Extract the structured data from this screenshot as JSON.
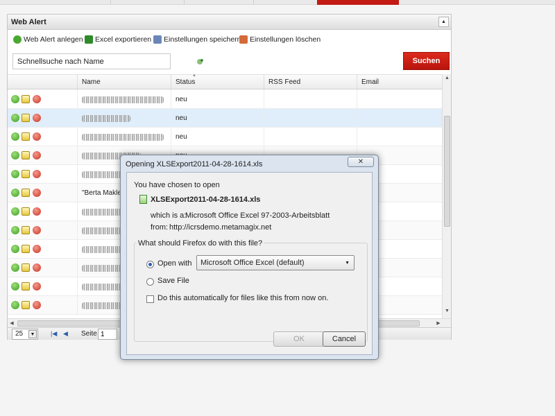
{
  "panel": {
    "title": "Web Alert"
  },
  "toolbar": {
    "items": [
      {
        "label": "Web Alert anlegen",
        "icon": "plus-circle-icon",
        "color": "#4aa832"
      },
      {
        "label": "Excel exportieren",
        "icon": "excel-icon",
        "color": "#2f8a2a"
      },
      {
        "label": "Einstellungen speichern",
        "icon": "save-settings-icon",
        "color": "#6a86b8"
      },
      {
        "label": "Einstellungen löschen",
        "icon": "delete-settings-icon",
        "color": "#d46a3a"
      }
    ]
  },
  "search": {
    "value": "Schnellsuche nach Name",
    "button": "Suchen"
  },
  "grid": {
    "columns": [
      "Name",
      "Status",
      "RSS Feed",
      "Email"
    ],
    "rows": [
      {
        "name": "",
        "status": "neu"
      },
      {
        "name": "",
        "status": "neu"
      },
      {
        "name": "",
        "status": "neu"
      },
      {
        "name": "\"",
        "status": "neu"
      },
      {
        "name": "",
        "status": ""
      },
      {
        "name": "\"Berta Makler\"",
        "status": ""
      },
      {
        "name": "",
        "status": ""
      },
      {
        "name": "",
        "status": ""
      },
      {
        "name": "",
        "status": ""
      },
      {
        "name": "",
        "status": ""
      },
      {
        "name": "",
        "status": ""
      },
      {
        "name": "",
        "status": ""
      }
    ]
  },
  "pager": {
    "page_size": "25",
    "page_label": "Seite",
    "page": "1"
  },
  "dialog": {
    "title": "Opening XLSExport2011-04-28-1614.xls",
    "close": "✕",
    "intro": "You have chosen to open",
    "filename": "XLSExport2011-04-28-1614.xls",
    "type_label": "which is a:",
    "type_value": "Microsoft Office Excel 97-2003-Arbeitsblatt",
    "from_label": "from:",
    "from_value": "http://icrsdemo.metamagix.net",
    "question": "What should Firefox do with this file?",
    "open_with": "Open with",
    "open_with_app": "Microsoft Office Excel (default)",
    "save_file": "Save File",
    "auto": "Do this automatically for files like this from now on.",
    "ok": "OK",
    "cancel": "Cancel"
  }
}
